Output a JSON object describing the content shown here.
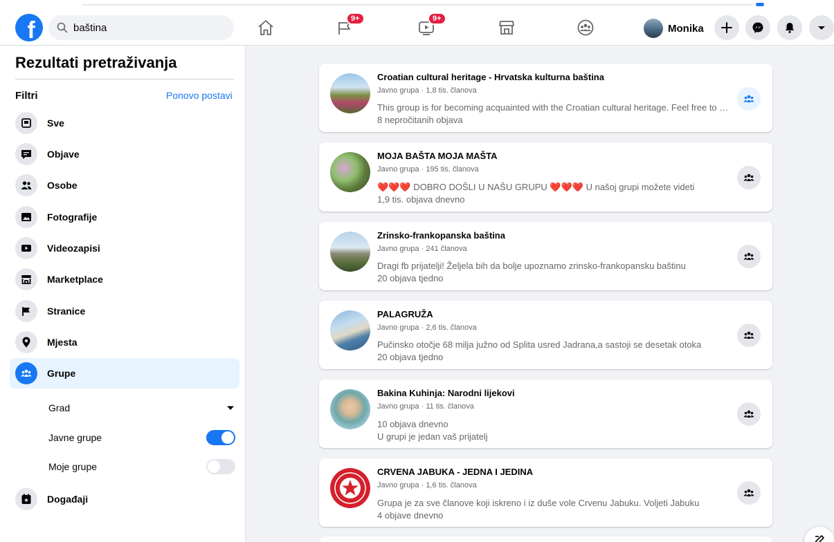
{
  "header": {
    "logo_letter": "f",
    "search_value": "baština",
    "nav_badges": {
      "pages": "9+",
      "watch": "9+"
    },
    "profile_name": "Monika"
  },
  "sidebar": {
    "title": "Rezultati pretraživanja",
    "filters_label": "Filtri",
    "reset_label": "Ponovo postavi",
    "items": [
      {
        "label": "Sve",
        "icon": "all-icon"
      },
      {
        "label": "Objave",
        "icon": "posts-icon"
      },
      {
        "label": "Osobe",
        "icon": "people-icon"
      },
      {
        "label": "Fotografije",
        "icon": "photos-icon"
      },
      {
        "label": "Videozapisi",
        "icon": "video-icon"
      },
      {
        "label": "Marketplace",
        "icon": "marketplace-icon"
      },
      {
        "label": "Stranice",
        "icon": "pages-flag-icon"
      },
      {
        "label": "Mjesta",
        "icon": "location-pin-icon"
      },
      {
        "label": "Grupe",
        "icon": "groups-icon",
        "active": true
      },
      {
        "label": "Događaji",
        "icon": "events-calendar-icon"
      }
    ],
    "sub_filters": {
      "city_label": "Grad",
      "public_groups_label": "Javne grupe",
      "public_groups_on": true,
      "my_groups_label": "Moje grupe",
      "my_groups_on": false
    }
  },
  "results": [
    {
      "title": "Croatian cultural heritage - Hrvatska kulturna baština",
      "meta": "Javno grupa · 1,8 tis. članova",
      "description": "This group is for becoming acquainted with the Croatian cultural heritage. Feel free to share",
      "stat": "8 nepročitanih objava",
      "member": true
    },
    {
      "title": "MOJA BAŠTA MOJA MAŠTA",
      "meta": "Javno grupa · 195 tis. članova",
      "hearts": "❤️❤️❤️",
      "description": "DOBRO DOŠLI U NAŠU GRUPU",
      "hearts2": "❤️❤️❤️",
      "description2": "U našoj grupi možete videti",
      "stat": "1,9 tis. objava dnevno"
    },
    {
      "title": "Zrinsko-frankopanska baština",
      "meta": "Javno grupa · 241 članova",
      "description": "Dragi fb prijatelji! Željela bih da bolje upoznamo zrinsko-frankopansku baštinu",
      "stat": "20 objava tjedno"
    },
    {
      "title": "PALAGRUŽA",
      "meta": "Javno grupa · 2,6 tis. članova",
      "description": "Pučinsko otočje 68 milja južno od Splita usred Jadrana,a sastoji se desetak otoka",
      "stat": "20 objava tjedno"
    },
    {
      "title": "Bakina Kuhinja: Narodni lijekovi",
      "meta": "Javno grupa · 11 tis. članova",
      "stat": "10 objava dnevno",
      "stat2": "U grupi je jedan vaš prijatelj"
    },
    {
      "title": "CRVENA JABUKA - JEDNA I JEDINA",
      "meta": "Javno grupa · 1,6 tis. članova",
      "description": "Grupa je za sve članove koji iskreno i iz duše vole Crvenu Jabuku. Voljeti Jabuku",
      "stat": "4 objave dnevno"
    }
  ],
  "colors": {
    "brand": "#1877f2",
    "background": "#f0f2f5",
    "badge": "#e41e3f",
    "secondary_text": "#65676b"
  }
}
